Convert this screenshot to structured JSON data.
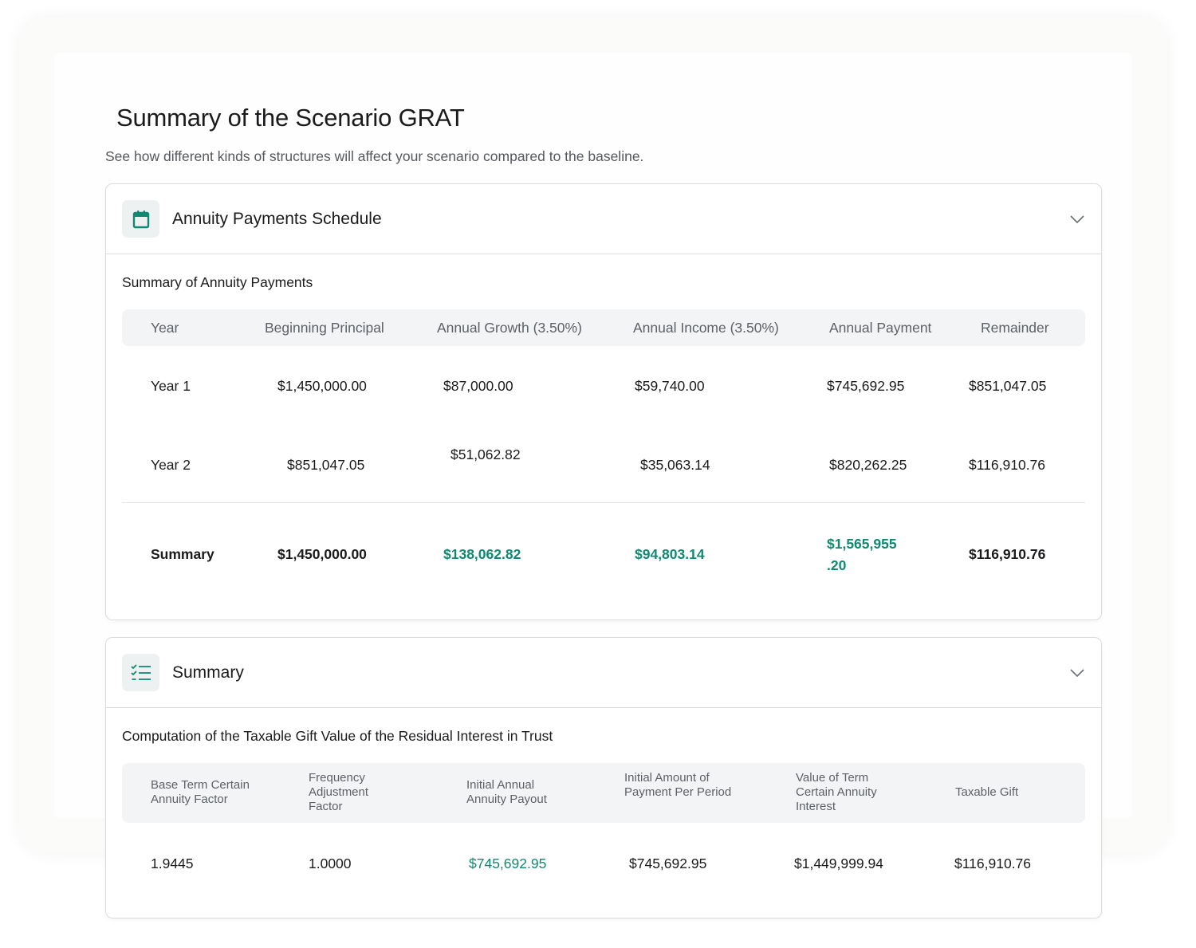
{
  "page": {
    "title": "Summary of the Scenario GRAT",
    "subtitle": "See how different kinds of structures will affect your scenario compared to the baseline."
  },
  "colors": {
    "accent": "#0f8a71",
    "icon_bg": "#eef1f2",
    "table_header_bg": "#f3f4f6"
  },
  "schedule": {
    "title": "Annuity Payments Schedule",
    "icon": "calendar-icon",
    "section_label": "Summary of  Annuity Payments",
    "headers": [
      "Year",
      "Beginning Principal",
      "Annual Growth (3.50%)",
      "Annual Income (3.50%)",
      "Annual Payment",
      "Remainder"
    ],
    "rows": [
      [
        "Year 1",
        "$1,450,000.00",
        "$87,000.00",
        "$59,740.00",
        "$745,692.95",
        "$851,047.05"
      ],
      [
        "Year 2",
        "$851,047.05",
        "$51,062.82",
        "$35,063.14",
        "$820,262.25",
        "$116,910.76"
      ]
    ],
    "summary": {
      "label": "Summary",
      "beginning_principal": "$1,450,000.00",
      "annual_growth": "$138,062.82",
      "annual_income": "$94,803.14",
      "annual_payment_line1": "$1,565,955",
      "annual_payment_line2": ".20",
      "remainder": "$116,910.76"
    }
  },
  "summary_card": {
    "title": "Summary",
    "icon": "checklist-icon",
    "section_label": "Computation of the Taxable Gift Value of the Residual Interest in Trust",
    "headers": [
      "Base Term Certain Annuity Factor",
      "Frequency Adjustment Factor",
      "Initial Annual Annuity Payout",
      "Initial Amount of Payment Per Period",
      "Value of Term Certain Annuity Interest",
      "Taxable Gift"
    ],
    "row": [
      "1.9445",
      "1.0000",
      "$745,692.95",
      "$745,692.95",
      "$1,449,999.94",
      "$116,910.76"
    ]
  }
}
